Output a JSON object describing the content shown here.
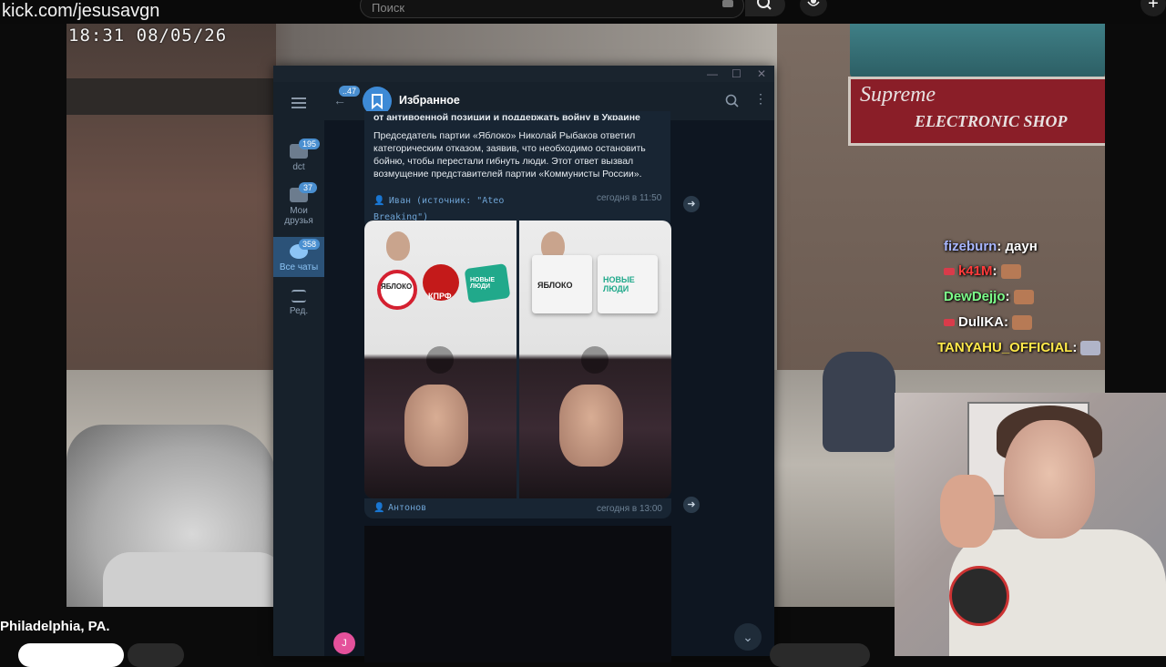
{
  "browser": {
    "url": "kick.com/jesusavgn",
    "search_placeholder": "Поиск"
  },
  "video": {
    "timestamp": "18:31  08/05/26",
    "sign_line1": "Supreme",
    "sign_line2": "ELECTRONIC SHOP",
    "location": "Philadelphia, PA."
  },
  "telegram": {
    "chat_title": "Избранное",
    "back_badge": "47",
    "folders": [
      {
        "label": "dct",
        "badge": "195"
      },
      {
        "label": "Мои друзья",
        "badge": "37"
      },
      {
        "label": "Все чаты",
        "badge": "358"
      },
      {
        "label": "Ред.",
        "badge": ""
      }
    ],
    "message1": {
      "cut_line": "от антивоенной позиции и поддержать войну в Украине",
      "body": "Председатель партии «Яблоко» Николай Рыбаков ответил категорическим отказом, заявив, что необходимо остановить бойню, чтобы перестали гибнуть люди. Этот ответ вызвал возмущение представителей партии «Коммунисты России».",
      "sender": "Иван (источник: \"Ateo Breaking\")",
      "time": "сегодня в 11:50"
    },
    "message2": {
      "logo_yabloko": "ЯБЛОКО",
      "logo_kprf": "КПРФ",
      "logo_newpeople": "НОВЫЕ ЛЮДИ",
      "sender": "Антонов",
      "time": "сегодня в 13:00"
    },
    "avatar_letter": "J"
  },
  "stream_chat": [
    {
      "user": "fizeburn",
      "text": ": даун",
      "color": "#a8b6ff"
    },
    {
      "user": "k41M",
      "text": ":",
      "color": "#ff3b3b"
    },
    {
      "user": "DewDejjo",
      "text": ":",
      "color": "#7dff8a"
    },
    {
      "user": "DulIKA",
      "text": ":",
      "color": "#ffffff"
    },
    {
      "user": "TANYAHU_OFFICIAL",
      "text": ":",
      "color": "#ffe94a"
    }
  ]
}
